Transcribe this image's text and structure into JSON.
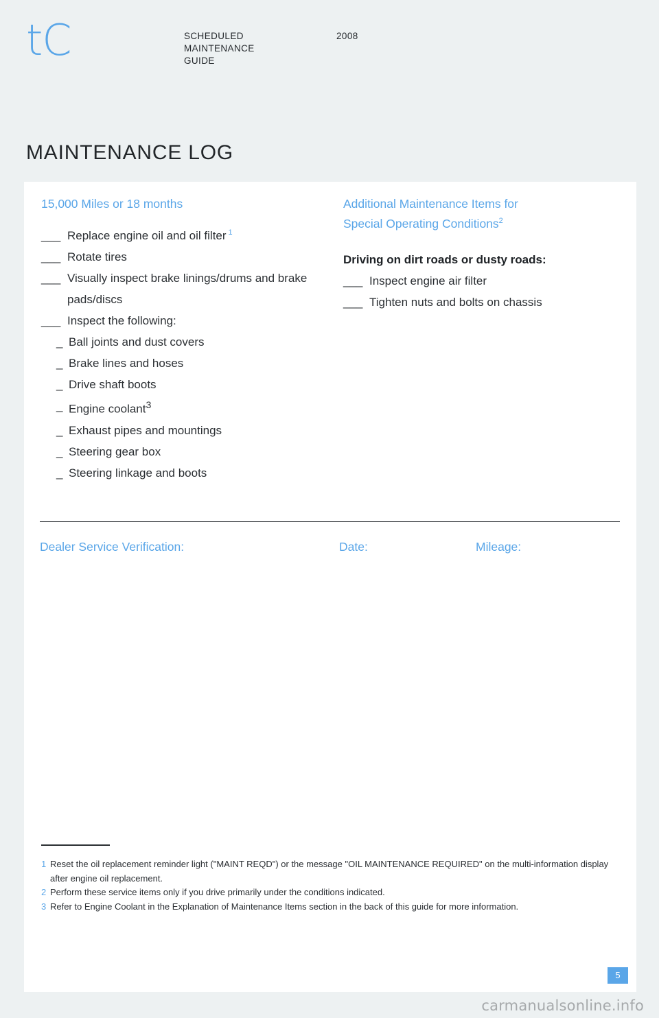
{
  "header": {
    "logo": "tC",
    "guide_title": "SCHEDULED\nMAINTENANCE\nGUIDE",
    "guide_title_line1": "SCHEDULED",
    "guide_title_line2": "MAINTENANCE",
    "guide_title_line3": "GUIDE",
    "year": "2008"
  },
  "section_title": "MAINTENANCE LOG",
  "colors": {
    "accent_blue": "#5aa6e8",
    "page_background": "#edf1f2",
    "sheet_background": "#ffffff",
    "text": "#2b2f33",
    "watermark": "#a6a9ab"
  },
  "left_column": {
    "heading": "15,000 Miles or 18 months",
    "items": [
      {
        "blank": "___",
        "label": "Replace engine oil and oil filter",
        "footnote_ref": "1"
      },
      {
        "blank": "___",
        "label": "Rotate tires",
        "footnote_ref": ""
      },
      {
        "blank": "___",
        "label": "Visually inspect brake linings/drums and brake pads/discs",
        "footnote_ref": ""
      },
      {
        "blank": "___",
        "label": "Inspect the following:",
        "footnote_ref": ""
      }
    ],
    "sub_items": [
      {
        "dash": "_",
        "label": "Ball joints and dust covers",
        "footnote_ref": ""
      },
      {
        "dash": "_",
        "label": "Brake lines and hoses",
        "footnote_ref": ""
      },
      {
        "dash": "_",
        "label": "Drive shaft boots",
        "footnote_ref": ""
      },
      {
        "dash": "_",
        "label": "Engine coolant",
        "footnote_ref": "3"
      },
      {
        "dash": "_",
        "label": "Exhaust pipes and mountings",
        "footnote_ref": ""
      },
      {
        "dash": "_",
        "label": "Steering gear box",
        "footnote_ref": ""
      },
      {
        "dash": "_",
        "label": "Steering linkage and boots",
        "footnote_ref": ""
      }
    ]
  },
  "right_column": {
    "heading_line1": "Additional Maintenance Items for",
    "heading_line2": "Special Operating Conditions",
    "heading_footnote_ref": "2",
    "subheading": "Driving on dirt roads or dusty roads:",
    "items": [
      {
        "blank": "___",
        "label": "Inspect engine air filter"
      },
      {
        "blank": "___",
        "label": "Tighten nuts and bolts on chassis"
      }
    ]
  },
  "verification": {
    "dealer_label": "Dealer Service Verification:",
    "date_label": "Date:",
    "mileage_label": "Mileage:"
  },
  "footnotes": [
    {
      "num": "1",
      "text": "Reset the oil replacement reminder light (\"MAINT REQD\") or the message \"OIL MAINTENANCE REQUIRED\" on the multi-information display after engine oil replacement."
    },
    {
      "num": "2",
      "text": "Perform these service items only if you drive primarily under the conditions indicated."
    },
    {
      "num": "3",
      "text": "Refer to Engine Coolant in the Explanation of Maintenance Items section in the back of this guide for more information."
    }
  ],
  "page_number": "5",
  "watermark": "carmanualsonline.info"
}
